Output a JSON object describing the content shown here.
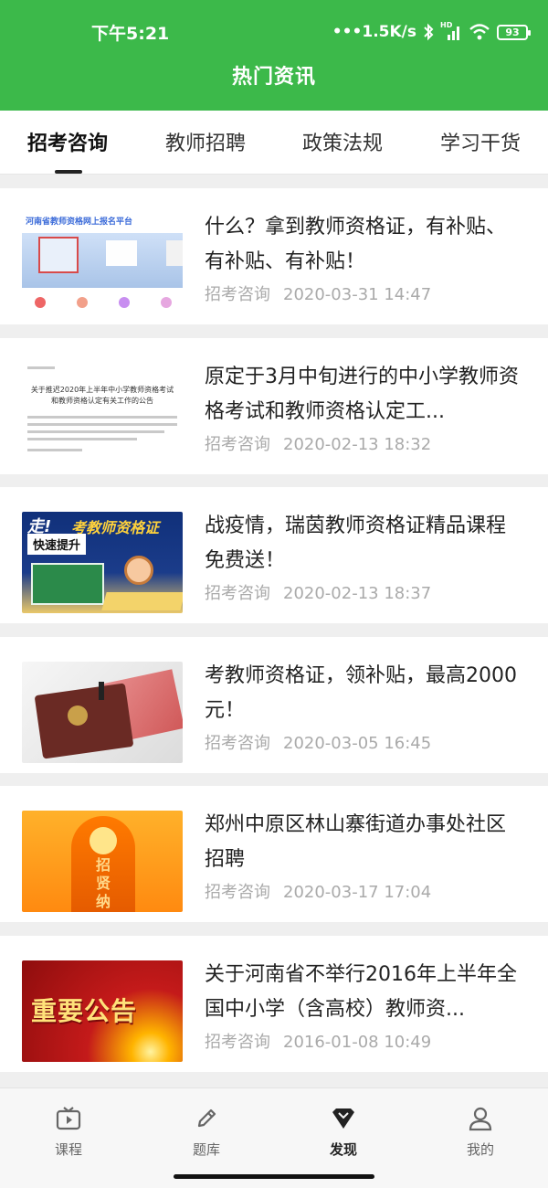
{
  "status_bar": {
    "time": "下午5:21",
    "net_speed": "•••1.5K/s",
    "hd_label": "HD",
    "battery": "93"
  },
  "header": {
    "title": "热门资讯"
  },
  "tabs": [
    {
      "label": "招考咨询",
      "active": true
    },
    {
      "label": "教师招聘",
      "active": false
    },
    {
      "label": "政策法规",
      "active": false
    },
    {
      "label": "学习干货",
      "active": false
    }
  ],
  "thumbnail_text": {
    "t1_header": "河南省教师资格网上报名平台",
    "t2_title": "关于推迟2020年上半年中小学教师资格考试和教师资格认定有关工作的公告",
    "t3_zou": "走!",
    "t3_kao": "考教师资格证",
    "t3_tag": "快速提升",
    "t5_text": "招贤纳士",
    "t6_text": "重要公告"
  },
  "news": [
    {
      "title": "什么？拿到教师资格证，有补贴、有补贴、有补贴！",
      "category": "招考咨询",
      "date": "2020-03-31 14:47"
    },
    {
      "title": "原定于3月中旬进行的中小学教师资格考试和教师资格认定工...",
      "category": "招考咨询",
      "date": "2020-02-13 18:32"
    },
    {
      "title": "战疫情，瑞茵教师资格证精品课程免费送！",
      "category": "招考咨询",
      "date": "2020-02-13 18:37"
    },
    {
      "title": "考教师资格证，领补贴，最高2000元！",
      "category": "招考咨询",
      "date": "2020-03-05 16:45"
    },
    {
      "title": "郑州中原区林山寨街道办事处社区招聘",
      "category": "招考咨询",
      "date": "2020-03-17 17:04"
    },
    {
      "title": "关于河南省不举行2016年上半年全国中小学（含高校）教师资...",
      "category": "招考咨询",
      "date": "2016-01-08 10:49"
    }
  ],
  "bottom_nav": [
    {
      "label": "课程",
      "icon": "video-icon",
      "active": false
    },
    {
      "label": "题库",
      "icon": "pencil-icon",
      "active": false
    },
    {
      "label": "发现",
      "icon": "diamond-icon",
      "active": true
    },
    {
      "label": "我的",
      "icon": "person-icon",
      "active": false
    }
  ]
}
